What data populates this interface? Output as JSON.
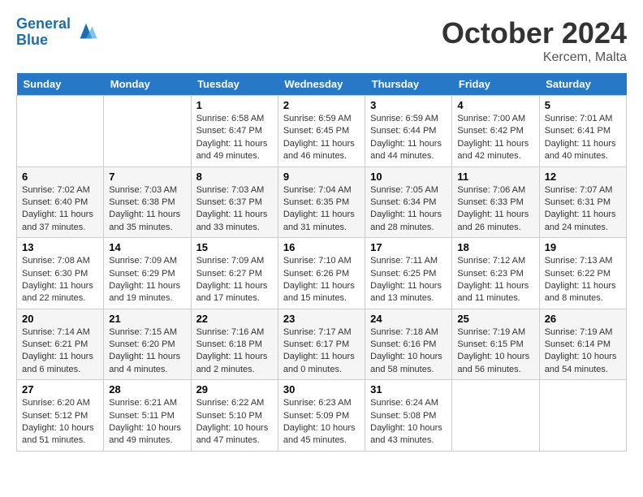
{
  "header": {
    "logo_line1": "General",
    "logo_line2": "Blue",
    "month": "October 2024",
    "location": "Kercem, Malta"
  },
  "weekdays": [
    "Sunday",
    "Monday",
    "Tuesday",
    "Wednesday",
    "Thursday",
    "Friday",
    "Saturday"
  ],
  "weeks": [
    [
      {
        "day": "",
        "detail": ""
      },
      {
        "day": "",
        "detail": ""
      },
      {
        "day": "1",
        "detail": "Sunrise: 6:58 AM\nSunset: 6:47 PM\nDaylight: 11 hours and 49 minutes."
      },
      {
        "day": "2",
        "detail": "Sunrise: 6:59 AM\nSunset: 6:45 PM\nDaylight: 11 hours and 46 minutes."
      },
      {
        "day": "3",
        "detail": "Sunrise: 6:59 AM\nSunset: 6:44 PM\nDaylight: 11 hours and 44 minutes."
      },
      {
        "day": "4",
        "detail": "Sunrise: 7:00 AM\nSunset: 6:42 PM\nDaylight: 11 hours and 42 minutes."
      },
      {
        "day": "5",
        "detail": "Sunrise: 7:01 AM\nSunset: 6:41 PM\nDaylight: 11 hours and 40 minutes."
      }
    ],
    [
      {
        "day": "6",
        "detail": "Sunrise: 7:02 AM\nSunset: 6:40 PM\nDaylight: 11 hours and 37 minutes."
      },
      {
        "day": "7",
        "detail": "Sunrise: 7:03 AM\nSunset: 6:38 PM\nDaylight: 11 hours and 35 minutes."
      },
      {
        "day": "8",
        "detail": "Sunrise: 7:03 AM\nSunset: 6:37 PM\nDaylight: 11 hours and 33 minutes."
      },
      {
        "day": "9",
        "detail": "Sunrise: 7:04 AM\nSunset: 6:35 PM\nDaylight: 11 hours and 31 minutes."
      },
      {
        "day": "10",
        "detail": "Sunrise: 7:05 AM\nSunset: 6:34 PM\nDaylight: 11 hours and 28 minutes."
      },
      {
        "day": "11",
        "detail": "Sunrise: 7:06 AM\nSunset: 6:33 PM\nDaylight: 11 hours and 26 minutes."
      },
      {
        "day": "12",
        "detail": "Sunrise: 7:07 AM\nSunset: 6:31 PM\nDaylight: 11 hours and 24 minutes."
      }
    ],
    [
      {
        "day": "13",
        "detail": "Sunrise: 7:08 AM\nSunset: 6:30 PM\nDaylight: 11 hours and 22 minutes."
      },
      {
        "day": "14",
        "detail": "Sunrise: 7:09 AM\nSunset: 6:29 PM\nDaylight: 11 hours and 19 minutes."
      },
      {
        "day": "15",
        "detail": "Sunrise: 7:09 AM\nSunset: 6:27 PM\nDaylight: 11 hours and 17 minutes."
      },
      {
        "day": "16",
        "detail": "Sunrise: 7:10 AM\nSunset: 6:26 PM\nDaylight: 11 hours and 15 minutes."
      },
      {
        "day": "17",
        "detail": "Sunrise: 7:11 AM\nSunset: 6:25 PM\nDaylight: 11 hours and 13 minutes."
      },
      {
        "day": "18",
        "detail": "Sunrise: 7:12 AM\nSunset: 6:23 PM\nDaylight: 11 hours and 11 minutes."
      },
      {
        "day": "19",
        "detail": "Sunrise: 7:13 AM\nSunset: 6:22 PM\nDaylight: 11 hours and 8 minutes."
      }
    ],
    [
      {
        "day": "20",
        "detail": "Sunrise: 7:14 AM\nSunset: 6:21 PM\nDaylight: 11 hours and 6 minutes."
      },
      {
        "day": "21",
        "detail": "Sunrise: 7:15 AM\nSunset: 6:20 PM\nDaylight: 11 hours and 4 minutes."
      },
      {
        "day": "22",
        "detail": "Sunrise: 7:16 AM\nSunset: 6:18 PM\nDaylight: 11 hours and 2 minutes."
      },
      {
        "day": "23",
        "detail": "Sunrise: 7:17 AM\nSunset: 6:17 PM\nDaylight: 11 hours and 0 minutes."
      },
      {
        "day": "24",
        "detail": "Sunrise: 7:18 AM\nSunset: 6:16 PM\nDaylight: 10 hours and 58 minutes."
      },
      {
        "day": "25",
        "detail": "Sunrise: 7:19 AM\nSunset: 6:15 PM\nDaylight: 10 hours and 56 minutes."
      },
      {
        "day": "26",
        "detail": "Sunrise: 7:19 AM\nSunset: 6:14 PM\nDaylight: 10 hours and 54 minutes."
      }
    ],
    [
      {
        "day": "27",
        "detail": "Sunrise: 6:20 AM\nSunset: 5:12 PM\nDaylight: 10 hours and 51 minutes."
      },
      {
        "day": "28",
        "detail": "Sunrise: 6:21 AM\nSunset: 5:11 PM\nDaylight: 10 hours and 49 minutes."
      },
      {
        "day": "29",
        "detail": "Sunrise: 6:22 AM\nSunset: 5:10 PM\nDaylight: 10 hours and 47 minutes."
      },
      {
        "day": "30",
        "detail": "Sunrise: 6:23 AM\nSunset: 5:09 PM\nDaylight: 10 hours and 45 minutes."
      },
      {
        "day": "31",
        "detail": "Sunrise: 6:24 AM\nSunset: 5:08 PM\nDaylight: 10 hours and 43 minutes."
      },
      {
        "day": "",
        "detail": ""
      },
      {
        "day": "",
        "detail": ""
      }
    ]
  ]
}
